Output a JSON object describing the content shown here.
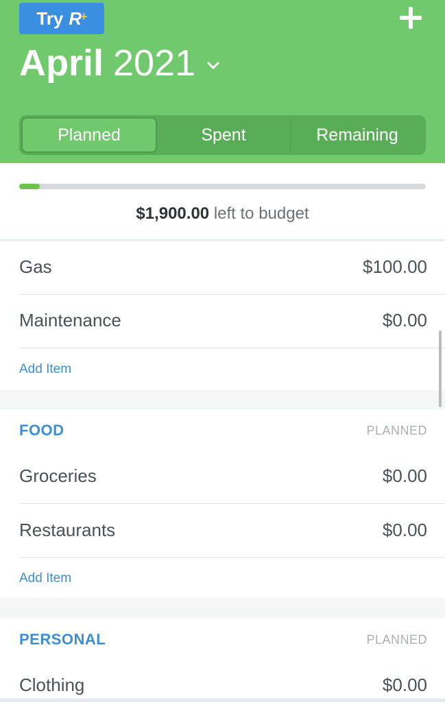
{
  "header": {
    "try_label": "Try",
    "rplus_badge": "R",
    "rplus_plus": "+",
    "add_icon": "plus-icon",
    "month": "April",
    "year": "2021",
    "chevron_icon": "chevron-down-icon",
    "colors": {
      "background": "#70c96c",
      "try_button": "#3a8fe0",
      "accent_plus": "#f5c542"
    }
  },
  "tabs": [
    {
      "label": "Planned",
      "active": true
    },
    {
      "label": "Spent",
      "active": false
    },
    {
      "label": "Remaining",
      "active": false
    }
  ],
  "summary": {
    "amount": "$1,900.00",
    "text": " left to budget",
    "progress_fraction": 0.05,
    "progress_color": "#6cc24a"
  },
  "groups": {
    "transportation": {
      "items": [
        {
          "label": "Gas",
          "value": "$100.00"
        },
        {
          "label": "Maintenance",
          "value": "$0.00"
        }
      ],
      "add_item": "Add Item"
    },
    "food": {
      "name": "FOOD",
      "column": "PLANNED",
      "items": [
        {
          "label": "Groceries",
          "value": "$0.00"
        },
        {
          "label": "Restaurants",
          "value": "$0.00"
        }
      ],
      "add_item": "Add Item"
    },
    "personal": {
      "name": "PERSONAL",
      "column": "PLANNED",
      "items": [
        {
          "label": "Clothing",
          "value": "$0.00"
        }
      ]
    }
  },
  "link_color": "#3a8fd6"
}
